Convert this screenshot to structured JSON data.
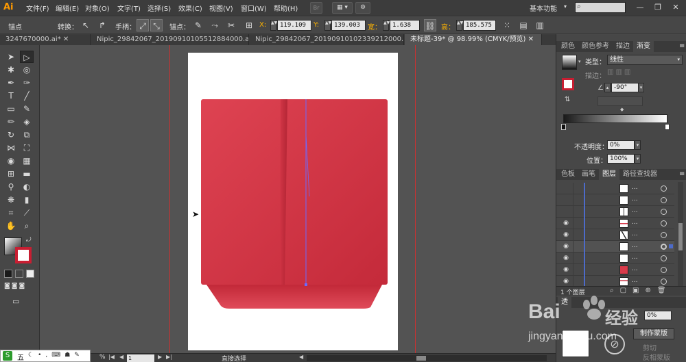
{
  "app": {
    "logo": "Ai"
  },
  "menu": {
    "items": [
      "文件(F)",
      "编辑(E)",
      "对象(O)",
      "文字(T)",
      "选择(S)",
      "效果(C)",
      "视图(V)",
      "窗口(W)",
      "帮助(H)"
    ],
    "bridge": "Br",
    "workspace": "基本功能",
    "search_placeholder": ""
  },
  "control": {
    "anchor_label": "锚点",
    "convert_label": "转换：",
    "handle_label": "手柄：",
    "anchor2_label": "锚点：",
    "x_label": "X:",
    "x_value": "119.109",
    "y_label": "Y:",
    "y_value": "139.003",
    "w_label": "宽：",
    "w_value": "1.638",
    "h_label": "高：",
    "h_value": "185.575"
  },
  "tabs": [
    "3247670000.ai*",
    "Nipic_29842067_20190910105512884000.ai*",
    "Nipic_29842067_20190910102339212000.ai*",
    "未标题-39* @ 98.99% (CMYK/预览)"
  ],
  "gradient_panel": {
    "tabs": [
      "颜色",
      "颜色参考",
      "描边",
      "渐变"
    ],
    "type_label": "类型：",
    "type_value": "线性",
    "stroke_label": "描边：",
    "angle_value": "-90°",
    "opacity_label": "不透明度：",
    "opacity_value": "0%",
    "location_label": "位置：",
    "location_value": "100%"
  },
  "layers_panel": {
    "tabs": [
      "色板",
      "画笔",
      "图层",
      "路径查找器"
    ],
    "rows": [
      {
        "eye": false,
        "thumb": "white",
        "dots": "..."
      },
      {
        "eye": false,
        "thumb": "white",
        "dots": "..."
      },
      {
        "eye": false,
        "thumb": "line",
        "dots": "..."
      },
      {
        "eye": true,
        "thumb": "red-line",
        "dots": "..."
      },
      {
        "eye": true,
        "thumb": "diag",
        "dots": "..."
      },
      {
        "eye": true,
        "thumb": "white",
        "dots": "...",
        "selected": true
      },
      {
        "eye": true,
        "thumb": "white",
        "dots": "..."
      },
      {
        "eye": true,
        "thumb": "red",
        "dots": "..."
      },
      {
        "eye": true,
        "thumb": "redline",
        "dots": "..."
      }
    ],
    "layer_count": "1 个图层"
  },
  "lower_panel": {
    "tab": "透",
    "value": "0%",
    "make_mask": "制作蒙版",
    "clip": "剪切",
    "invert_mask": "反相蒙版"
  },
  "status": {
    "zoom": "%",
    "page": "1",
    "tool": "直接选择"
  },
  "taskbar": {
    "ime": "五"
  },
  "watermark": {
    "brand": "Bai",
    "brand2": "经验",
    "url": "jingyan.baidu.com"
  },
  "colors": {
    "bag_red": "#d93a4a",
    "bag_dark": "#c42a3a",
    "selection_blue": "#6a6aff",
    "guide_red": "#c83232",
    "xy_accent": "#ffb400"
  }
}
